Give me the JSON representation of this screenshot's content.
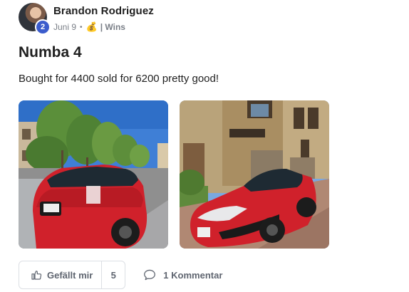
{
  "post": {
    "author": "Brandon Rodriguez",
    "level": "2",
    "date": "Juni 9",
    "separator": "•",
    "bag_icon": "💰",
    "category": "| Wins",
    "title": "Numba 4",
    "body": "Bought for 4400 sold for 6200 pretty good!"
  },
  "actions": {
    "like_label": "Gefällt mir",
    "like_count": "5",
    "comment_label": "1 Kommentar"
  },
  "colors": {
    "badge": "#3b5ccc",
    "car_red": "#d0212b",
    "muted_text": "#5f6570"
  },
  "icons": [
    "thumbs-up-icon",
    "comment-bubble-icon",
    "money-bag-icon"
  ]
}
